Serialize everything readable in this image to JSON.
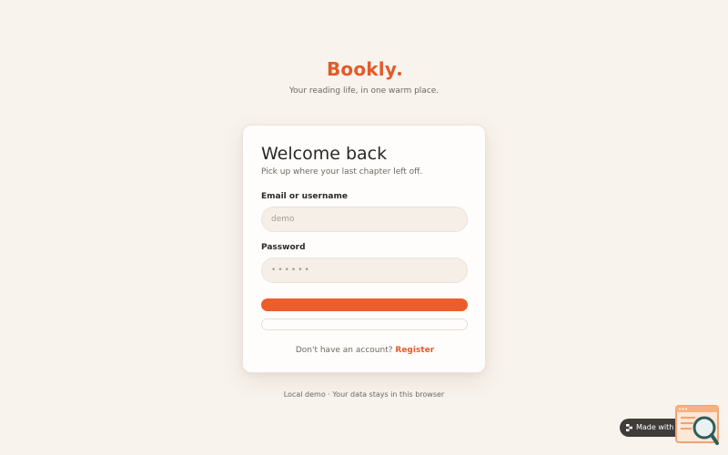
{
  "brand": {
    "name": "Bookly",
    "tagline": "Your reading life, in one warm place.",
    "accent_color": "#e45a2a"
  },
  "login_card": {
    "title": "Welcome back",
    "subtitle": "Pick up where your last chapter left off.",
    "email_label": "Email or username",
    "email_value": "demo",
    "password_label": "Password",
    "password_value": "••••••",
    "primary_button_label": "",
    "secondary_button_label": "",
    "register_prompt": "Don't have an account?",
    "register_link": "Register"
  },
  "footer": {
    "note": "Local demo · Your data stays in this browser"
  },
  "badge": {
    "label": "Made with Replit",
    "icon": "replit-icon"
  },
  "corner_widget": {
    "icon": "search-zoom-icon"
  },
  "colors": {
    "background": "#f8f3ed",
    "primary_button": "#ec5d2b",
    "card": "#fffdfb"
  }
}
